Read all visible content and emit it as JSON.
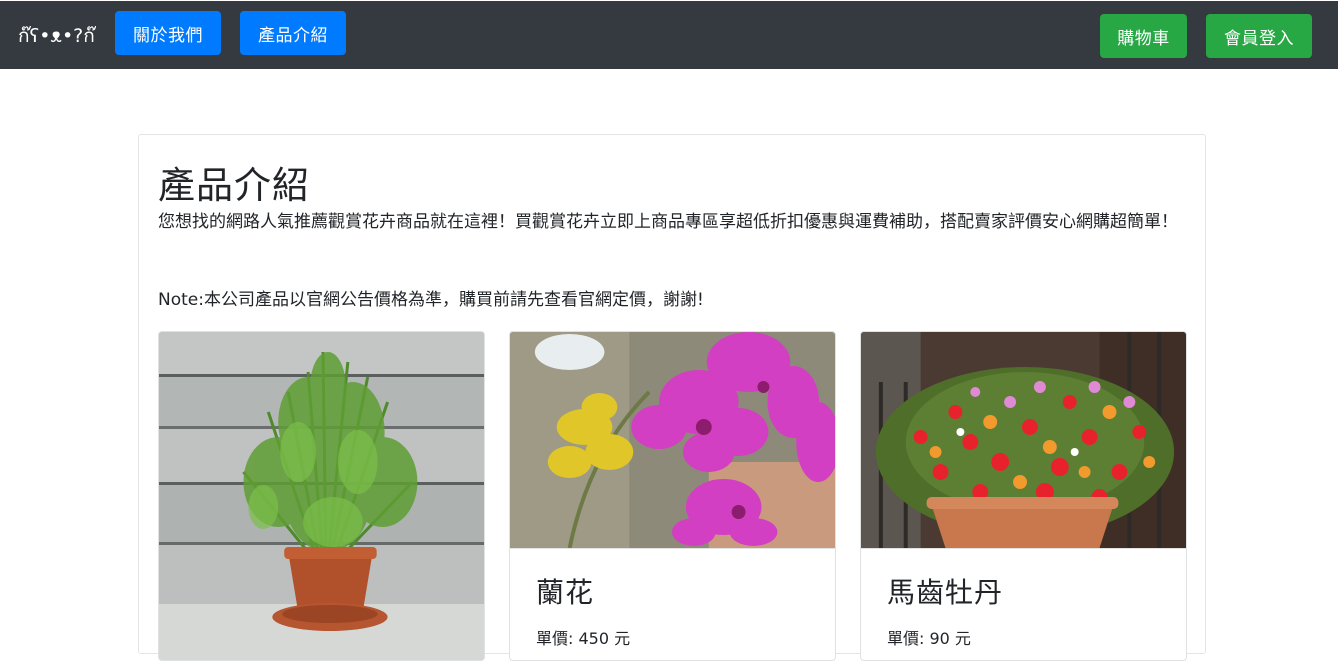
{
  "navbar": {
    "logo_icon": "cat-face-logo-icon",
    "logo_text": "ก๊ʕ•ᴥ•?ก๊",
    "about_label": "關於我們",
    "products_label": "產品介紹",
    "cart_label": "購物車",
    "login_label": "會員登入",
    "colors": {
      "bar": "#343a40",
      "primary": "#007bff",
      "success": "#28a745"
    }
  },
  "main": {
    "title": "產品介紹",
    "intro": "您想找的網路人氣推薦觀賞花卉商品就在這裡！買觀賞花卉立即上商品專區享超低折扣優惠與運費補助，搭配賣家評價安心網購超簡單！",
    "note": "Note:本公司產品以官網公告價格為準，購買前請先查看官網定價，謝謝!"
  },
  "products": [
    {
      "image": "rosemary-potted-plant-photo",
      "name": "",
      "price": ""
    },
    {
      "image": "pink-orchid-flowers-photo",
      "name": "蘭花",
      "price": "單價: 450 元"
    },
    {
      "image": "portulaca-flower-pot-photo",
      "name": "馬齒牡丹",
      "price": "單價: 90 元"
    }
  ]
}
